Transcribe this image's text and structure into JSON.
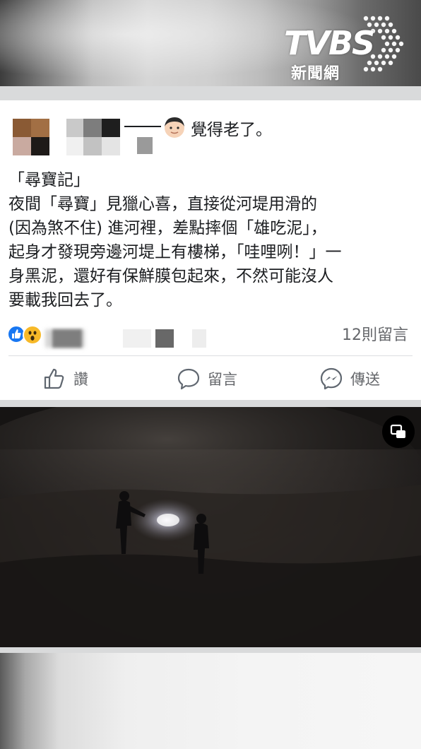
{
  "header": {
    "logo_main": "TVBS",
    "logo_sub": "新聞網"
  },
  "post": {
    "feeling_text": "覺得老了。",
    "feeling_icon": "person-face-icon",
    "body": "「尋寶記」\n夜間「尋寶」見獵心喜，直接從河堤用滑的\n(因為煞不住) 進河裡，差點摔個「雄吃泥」，\n起身才發現旁邊河堤上有樓梯，「哇哩咧！」一\n身黑泥，還好有保鮮膜包起來，不然可能沒人\n要載我回去了。",
    "reactions": [
      "like-icon",
      "wow-icon"
    ],
    "comments_count": "12則留言",
    "actions": [
      {
        "label": "讚",
        "icon": "thumbs-up-icon"
      },
      {
        "label": "留言",
        "icon": "comment-icon"
      },
      {
        "label": "傳送",
        "icon": "messenger-icon"
      }
    ]
  },
  "video": {
    "pip_icon": "picture-in-picture-icon"
  },
  "colors": {
    "text": "#1c1e21",
    "secondary": "#65676b",
    "like_blue": "#1877f2",
    "wow_yellow": "#f7b928"
  }
}
